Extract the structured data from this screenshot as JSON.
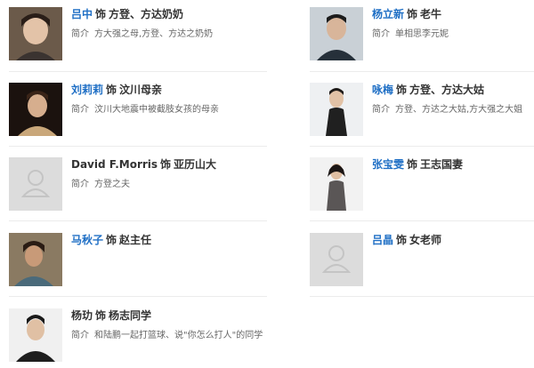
{
  "label_intro": "简介",
  "sep": "饰",
  "cast": [
    {
      "name": "吕中",
      "role": "方登、方达奶奶",
      "desc": "方大强之母,方登、方达之奶奶",
      "linked": true,
      "photo": "portrait"
    },
    {
      "name": "杨立新",
      "role": "老牛",
      "desc": "单相思李元妮",
      "linked": true,
      "photo": "portrait"
    },
    {
      "name": "刘莉莉",
      "role": "汶川母亲",
      "desc": "汶川大地震中被截肢女孩的母亲",
      "linked": true,
      "photo": "portrait"
    },
    {
      "name": "咏梅",
      "role": "方登、方达大姑",
      "desc": "方登、方达之大姑,方大强之大姐",
      "linked": true,
      "photo": "portrait"
    },
    {
      "name": "David F.Morris",
      "role": "亚历山大",
      "desc": "方登之夫",
      "linked": false,
      "photo": "placeholder"
    },
    {
      "name": "张宝雯",
      "role": "王志国妻",
      "desc": "",
      "linked": true,
      "photo": "portrait"
    },
    {
      "name": "马秋子",
      "role": "赵主任",
      "desc": "",
      "linked": true,
      "photo": "portrait"
    },
    {
      "name": "吕晶",
      "role": "女老师",
      "desc": "",
      "linked": true,
      "photo": "placeholder"
    },
    {
      "name": "杨玏",
      "role": "杨志同学",
      "desc": "和陆鹏一起打篮球、说\"你怎么打人\"的同学",
      "linked": false,
      "photo": "portrait"
    }
  ],
  "colors": {
    "link": "#1f6fc5",
    "text": "#333333",
    "muted": "#666666"
  }
}
